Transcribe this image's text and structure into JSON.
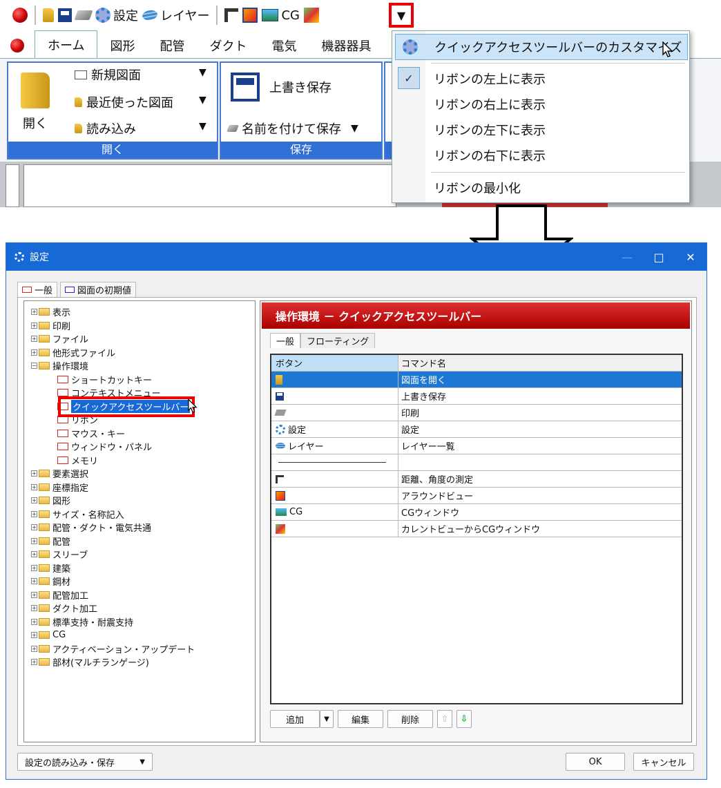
{
  "qat": {
    "items": [
      {
        "icon": "app-logo-icon"
      },
      {
        "icon": "folder-open-icon"
      },
      {
        "icon": "save-icon"
      },
      {
        "icon": "print-icon"
      },
      {
        "icon": "gear-icon",
        "label": "設定"
      },
      {
        "icon": "layer-icon",
        "label": "レイヤー"
      },
      {
        "icon": "ruler-icon"
      },
      {
        "icon": "around-view-icon"
      },
      {
        "icon": "cg-window-icon",
        "label": "CG"
      },
      {
        "icon": "current-view-cg-icon"
      }
    ],
    "dropdown_glyph": "▼"
  },
  "ribbon": {
    "tabs": [
      "ホーム",
      "図形",
      "配管",
      "ダクト",
      "電気",
      "機器器具"
    ],
    "open_group": {
      "big_label": "開く",
      "items": [
        "新規図面",
        "最近使った図面",
        "読み込み"
      ],
      "footer": "開く"
    },
    "save_group": {
      "big_label": "上書き保存",
      "item": "名前を付けて保存",
      "footer": "保存"
    }
  },
  "menu": {
    "customize": "クイックアクセスツールバーのカスタマイズ",
    "options": [
      "リボンの左上に表示",
      "リボンの右上に表示",
      "リボンの左下に表示",
      "リボンの右下に表示"
    ],
    "checked_index": 0,
    "minimize": "リボンの最小化",
    "check_glyph": "✓"
  },
  "dialog": {
    "title": "設定",
    "window_controls": {
      "minimize": "—",
      "maximize": "□",
      "close": "✕"
    },
    "tabs": [
      "一般",
      "図面の初期値"
    ],
    "tree": [
      {
        "label": "表示",
        "type": "folder",
        "expander": "+"
      },
      {
        "label": "印刷",
        "type": "folder",
        "expander": "+"
      },
      {
        "label": "ファイル",
        "type": "folder",
        "expander": "+"
      },
      {
        "label": "他形式ファイル",
        "type": "folder",
        "expander": "+"
      },
      {
        "label": "操作環境",
        "type": "folder",
        "expander": "−"
      },
      {
        "label": "ショートカットキー",
        "type": "child"
      },
      {
        "label": "コンテキストメニュー",
        "type": "child"
      },
      {
        "label": "クイックアクセスツールバー",
        "type": "child",
        "selected": true
      },
      {
        "label": "リボン",
        "type": "child"
      },
      {
        "label": "マウス・キー",
        "type": "child"
      },
      {
        "label": "ウィンドウ・パネル",
        "type": "child"
      },
      {
        "label": "メモリ",
        "type": "child"
      },
      {
        "label": "要素選択",
        "type": "folder",
        "expander": "+"
      },
      {
        "label": "座標指定",
        "type": "folder",
        "expander": "+"
      },
      {
        "label": "図形",
        "type": "folder",
        "expander": "+"
      },
      {
        "label": "サイズ・名称記入",
        "type": "folder",
        "expander": "+"
      },
      {
        "label": "配管・ダクト・電気共通",
        "type": "folder",
        "expander": "+"
      },
      {
        "label": "配管",
        "type": "folder",
        "expander": "+"
      },
      {
        "label": "スリーブ",
        "type": "folder",
        "expander": "+"
      },
      {
        "label": "建築",
        "type": "folder",
        "expander": "+"
      },
      {
        "label": "鋼材",
        "type": "folder",
        "expander": "+"
      },
      {
        "label": "配管加工",
        "type": "folder",
        "expander": "+"
      },
      {
        "label": "ダクト加工",
        "type": "folder",
        "expander": "+"
      },
      {
        "label": "標準支持・耐震支持",
        "type": "folder",
        "expander": "+"
      },
      {
        "label": "CG",
        "type": "folder",
        "expander": "+"
      },
      {
        "label": "アクティベーション・アップデート",
        "type": "folder",
        "expander": "+"
      },
      {
        "label": "部材(マルチランゲージ)",
        "type": "folder",
        "expander": "+"
      }
    ],
    "panel_title": "操作環境 － クイックアクセスツールバー",
    "panel_tabs": [
      "一般",
      "フローティング"
    ],
    "grid": {
      "headers": [
        "ボタン",
        "コマンド名"
      ],
      "rows": [
        {
          "icon": "folder-open-icon",
          "button": "",
          "command": "図面を開く",
          "selected": true
        },
        {
          "icon": "save-icon",
          "button": "",
          "command": "上書き保存"
        },
        {
          "icon": "print-icon",
          "button": "",
          "command": "印刷"
        },
        {
          "icon": "gear-icon",
          "button": "設定",
          "command": "設定"
        },
        {
          "icon": "layer-icon",
          "button": "レイヤー",
          "command": "レイヤー一覧"
        },
        {
          "icon": "separator",
          "button": "",
          "command": ""
        },
        {
          "icon": "ruler-icon",
          "button": "",
          "command": "距離、角度の測定"
        },
        {
          "icon": "around-view-icon",
          "button": "",
          "command": "アラウンドビュー"
        },
        {
          "icon": "cg-window-icon",
          "button": "CG",
          "command": "CGウィンドウ"
        },
        {
          "icon": "current-view-cg-icon",
          "button": "",
          "command": "カレントビューからCGウィンドウ"
        }
      ]
    },
    "buttons": {
      "add": "追加",
      "edit": "編集",
      "delete": "削除",
      "up": "⇧",
      "down": "⇩",
      "dd": "▼"
    },
    "footer": {
      "load_save": "設定の読み込み・保存",
      "ok": "OK",
      "cancel": "キャンセル"
    }
  }
}
